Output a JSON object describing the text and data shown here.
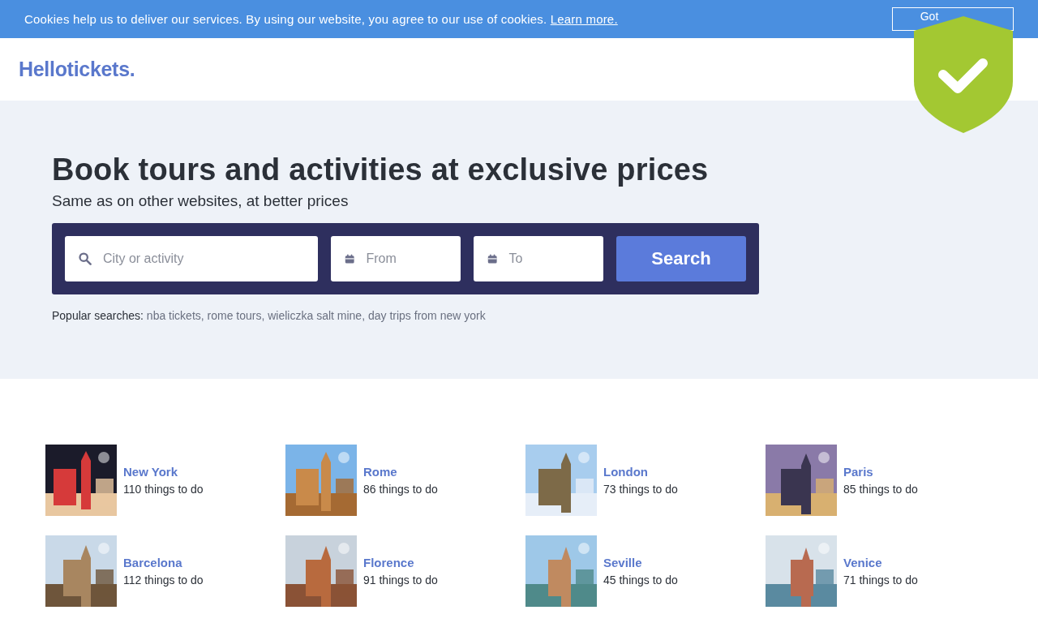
{
  "cookie_bar": {
    "message": "Cookies help us to deliver our services. By using our website, you agree to our use of cookies.",
    "link": "Learn more.",
    "button": "Got"
  },
  "header": {
    "logo": "Hellotickets."
  },
  "hero": {
    "title": "Book tours and activities at exclusive prices",
    "subtitle": "Same as on other websites, at better prices",
    "search": {
      "city_placeholder": "City or activity",
      "from_placeholder": "From",
      "to_placeholder": "To",
      "button": "Search"
    },
    "popular_label": "Popular searches:",
    "popular": "nba tickets, rome tours, wieliczka salt mine, day trips from new york"
  },
  "destinations": [
    {
      "name": "New York",
      "count": "110 things to do",
      "kind": "picture"
    },
    {
      "name": "Rome",
      "count": "86 things to do",
      "kind": "picture"
    },
    {
      "name": "London",
      "count": "73 things to do",
      "kind": "picture"
    },
    {
      "name": "Paris",
      "count": "85 things to do",
      "kind": "picture"
    },
    {
      "name": "Barcelona",
      "count": "112 things to do",
      "kind": "picture"
    },
    {
      "name": "Florence",
      "count": "91 things to do",
      "kind": "picture"
    },
    {
      "name": "Seville",
      "count": "45 things to do",
      "kind": "picture"
    },
    {
      "name": "Venice",
      "count": "71 things to do",
      "kind": "picture"
    }
  ]
}
